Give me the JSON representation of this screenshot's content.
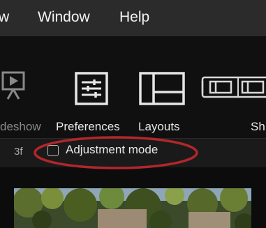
{
  "menu": {
    "items": [
      "w",
      "Window",
      "Help"
    ]
  },
  "toolbar": {
    "slideshow_label": "deshow",
    "preferences_label": "Preferences",
    "layouts_label": "Layouts",
    "show_label": "Sh",
    "icons": [
      "slideshow-icon",
      "preferences-icon",
      "layouts-icon",
      "view-mode-icon"
    ]
  },
  "subbar": {
    "prefix": "3f",
    "adjustment_mode": {
      "label": "Adjustment mode",
      "checked": false
    }
  },
  "colors": {
    "menubar_bg": "#2b2b2b",
    "toolbar_bg": "#101010",
    "annotation_red": "#b3262a"
  }
}
